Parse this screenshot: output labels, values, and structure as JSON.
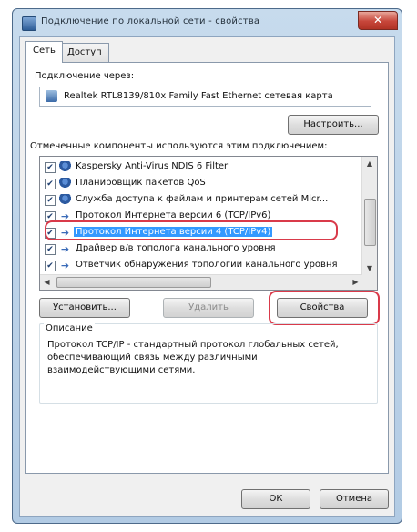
{
  "window": {
    "title": "Подключение по локальной сети - свойства",
    "close_label": "✕"
  },
  "tabs": [
    {
      "label": "Сеть",
      "active": true
    },
    {
      "label": "Доступ",
      "active": false
    }
  ],
  "connect_label": "Подключение через:",
  "adapter": {
    "name": "Realtek RTL8139/810x Family Fast Ethernet сетевая карта",
    "icon": "network-adapter-icon"
  },
  "configure_button": "Настроить...",
  "components_label": "Отмеченные компоненты используются этим подключением:",
  "components": [
    {
      "label": "Kaspersky Anti-Virus NDIS 6 Filter",
      "checked": true,
      "icon": "client-icon"
    },
    {
      "label": "Планировщик пакетов QoS",
      "checked": true,
      "icon": "service-icon"
    },
    {
      "label": "Служба доступа к файлам и принтерам сетей Micr...",
      "checked": true,
      "icon": "service-icon"
    },
    {
      "label": "Протокол Интернета версии 6 (TCP/IPv6)",
      "checked": true,
      "icon": "protocol-icon"
    },
    {
      "label": "Протокол Интернета версии 4 (TCP/IPv4)",
      "checked": true,
      "icon": "protocol-icon",
      "selected": true
    },
    {
      "label": "Драйвер в/в тополога канального уровня",
      "checked": true,
      "icon": "protocol-icon"
    },
    {
      "label": "Ответчик обнаружения топологии канального уровня",
      "checked": true,
      "icon": "protocol-icon"
    }
  ],
  "buttons": {
    "install": "Установить...",
    "remove": "Удалить",
    "properties": "Свойства"
  },
  "description": {
    "title": "Описание",
    "text": "Протокол TCP/IP - стандартный протокол глобальных сетей, обеспечивающий связь между различными взаимодействующими сетями."
  },
  "footer": {
    "ok": "ОК",
    "cancel": "Отмена"
  },
  "colors": {
    "highlight": "#d93a4a",
    "selection": "#3399ff"
  }
}
